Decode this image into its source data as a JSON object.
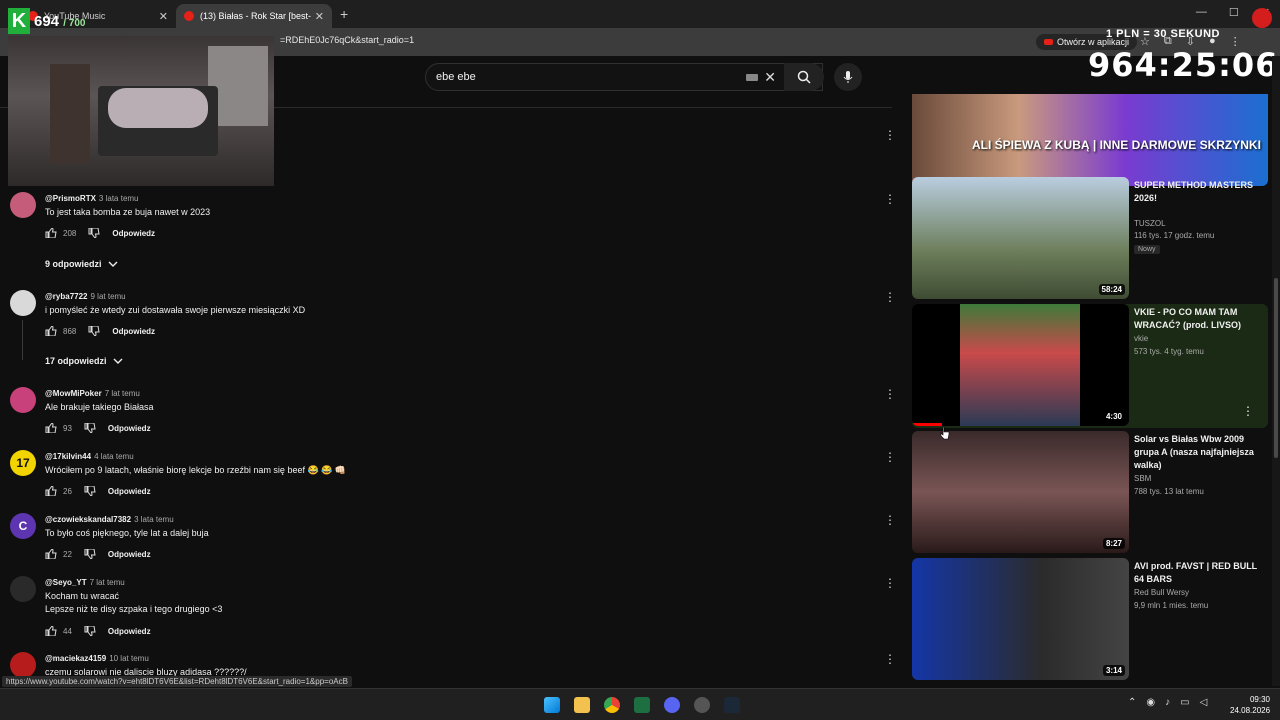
{
  "browser": {
    "tabs": [
      {
        "label": "YouTube Music",
        "active": false
      },
      {
        "label": "(13) Białas - Rok Star [best-",
        "active": true
      }
    ],
    "url": "=RDEhE0Jc76qCk&start_radio=1",
    "open_in_app": "Otwórz w aplikacji",
    "status_url": "https://www.youtube.com/watch?v=eht8lDT6V6E&list=RDeht8lDT6V6E&start_radio=1&pp=oAcB"
  },
  "overlay": {
    "badge_letter": "K",
    "count": "694",
    "count_max": "/ 700",
    "rate": "1 PLN = 30 SEKUND",
    "timer": "964:25:06"
  },
  "search": {
    "query": "ebe ebe"
  },
  "comments": [
    {
      "author": "@PrismoRTX",
      "time": "3 lata temu",
      "text": "To jest taka bomba ze buja nawet w 2023",
      "likes": "208",
      "reply": "Odpowiedz",
      "avatar_color": "#c55d7a",
      "avatar_text": ""
    },
    {
      "author": "@ryba7722",
      "time": "9 lat temu",
      "text": "i pomyśleć że wtedy zui dostawała swoje pierwsze miesiączki XD",
      "likes": "868",
      "reply": "Odpowiedz",
      "avatar_color": "#d9d9d9",
      "avatar_text": ""
    },
    {
      "author": "@MowMiPoker",
      "time": "7 lat temu",
      "text": "Ale brakuje takiego Białasa",
      "likes": "93",
      "reply": "Odpowiedz",
      "avatar_color": "#c8417a",
      "avatar_text": ""
    },
    {
      "author": "@17kilvin44",
      "time": "4 lata temu",
      "text": "Wróciłem po 9 latach, właśnie biorę lekcje bo rzeźbi nam się beef 😂 😂 👊🏻",
      "likes": "26",
      "reply": "Odpowiedz",
      "avatar_color": "#f2d400",
      "avatar_text": "17"
    },
    {
      "author": "@czowiekskandal7382",
      "time": "3 lata temu",
      "text": "To było coś pięknego, tyle lat a dalej buja",
      "likes": "22",
      "reply": "Odpowiedz",
      "avatar_color": "#5e35b1",
      "avatar_text": "C"
    },
    {
      "author": "@Seyo_YT",
      "time": "7 lat temu",
      "text": "Kocham tu wracać",
      "text2": "Lepsze niż te disy szpaka i tego drugiego <3",
      "likes": "44",
      "reply": "Odpowiedz",
      "avatar_color": "#2a2a2a",
      "avatar_text": ""
    },
    {
      "author": "@maciekaz4159",
      "time": "10 lat temu",
      "text": "czemu solarowi nie daliscie bluzy adidasa ??????/",
      "likes": "",
      "reply": "",
      "avatar_color": "#b71c1c",
      "avatar_text": ""
    }
  ],
  "replies_toggles": [
    {
      "label": "9 odpowiedzi"
    },
    {
      "label": "17 odpowiedzi"
    }
  ],
  "recommended": [
    {
      "title": "",
      "channel": "",
      "meta": "",
      "duration": "",
      "thumb_text": "ALI ŚPIEWA Z KUBĄ | INNE DARMOWE SKRZYNKI"
    },
    {
      "title": "SUPER METHOD MASTERS 2026!",
      "channel": "TUSZOL",
      "meta": "116 tys.  17 godz. temu",
      "badge": "Nowy",
      "duration": "58:24"
    },
    {
      "title": "VKIE - PO CO MAM TAM WRACAĆ? (prod. LIVSO)",
      "channel": "vkie",
      "meta": "573 tys.  4 tyg. temu",
      "duration": "4:30"
    },
    {
      "title": "Solar vs Białas Wbw 2009 grupa A (nasza najfajniejsza walka)",
      "channel": "SBM",
      "meta": "788 tys.  13 lat temu",
      "duration": "8:27"
    },
    {
      "title": "AVI prod. FAVST | RED BULL 64 BARS",
      "channel": "Red Bull Wersy",
      "meta": "9,9 mln  1 mies. temu",
      "duration": "3:14"
    }
  ],
  "taskbar": {
    "time": "09:30",
    "date": "24.08.2026"
  }
}
